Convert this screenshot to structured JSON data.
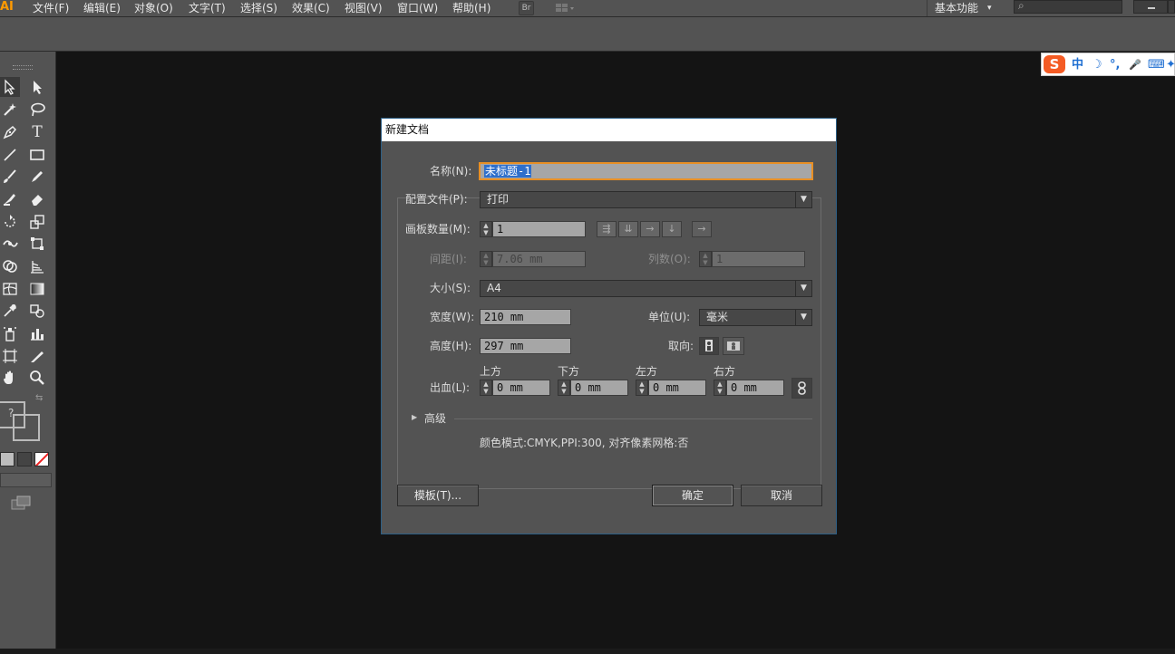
{
  "app": {
    "logo": "AI"
  },
  "menu": {
    "items": [
      "文件(F)",
      "编辑(E)",
      "对象(O)",
      "文字(T)",
      "选择(S)",
      "效果(C)",
      "视图(V)",
      "窗口(W)",
      "帮助(H)"
    ],
    "bridge_label": "Br",
    "workspace_label": "基本功能",
    "workspace_arrow": "▾",
    "search_icon_glyph": "⌕"
  },
  "ime": {
    "logo": "S",
    "items": [
      "中",
      "☽",
      "°,",
      "🎤",
      "⌨",
      "✦"
    ]
  },
  "tools": {
    "help_glyph": "?"
  },
  "dialog": {
    "title": "新建文档",
    "name_label": "名称(N):",
    "name_value": "未标题-1",
    "profile_label": "配置文件(P):",
    "profile_value": "打印",
    "artboards_label": "画板数量(M):",
    "artboards_value": "1",
    "spacing_label": "间距(I):",
    "spacing_value": "7.06 mm",
    "columns_label": "列数(O):",
    "columns_value": "1",
    "size_label": "大小(S):",
    "size_value": "A4",
    "width_label": "宽度(W):",
    "width_value": "210 mm",
    "units_label": "单位(U):",
    "units_value": "毫米",
    "height_label": "高度(H):",
    "height_value": "297 mm",
    "orientation_label": "取向:",
    "bleed_label": "出血(L):",
    "bleed_top_label": "上方",
    "bleed_bottom_label": "下方",
    "bleed_left_label": "左方",
    "bleed_right_label": "右方",
    "bleed_top": "0 mm",
    "bleed_bottom": "0 mm",
    "bleed_left": "0 mm",
    "bleed_right": "0 mm",
    "advanced_label": "高级",
    "info_text": "颜色模式:CMYK,PPI:300, 对齐像素网格:否",
    "templates_button": "模板(T)...",
    "ok_button": "确定",
    "cancel_button": "取消"
  }
}
